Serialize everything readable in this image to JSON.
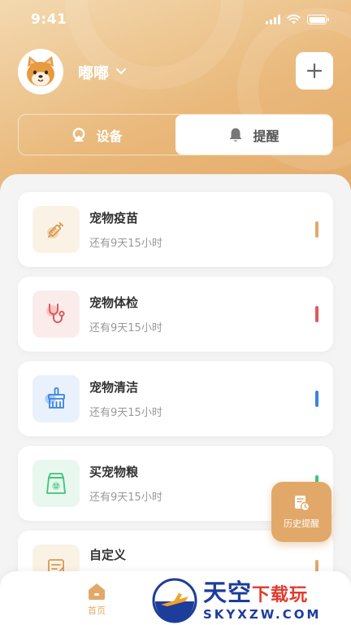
{
  "status_bar": {
    "time": "9:41"
  },
  "profile": {
    "pet_name": "嘟嘟"
  },
  "segment": {
    "tabs": [
      {
        "label": "设备",
        "icon": "location-pin-icon",
        "active": false
      },
      {
        "label": "提醒",
        "icon": "bell-icon",
        "active": true
      }
    ]
  },
  "reminders": [
    {
      "title": "宠物疫苗",
      "subtitle": "还有9天15小时",
      "icon": "syringe-icon",
      "accent": "#e2a869",
      "icon_bg": "#fbf2e6"
    },
    {
      "title": "宠物体检",
      "subtitle": "还有9天15小时",
      "icon": "stethoscope-icon",
      "accent": "#e05a5a",
      "icon_bg": "#fbecec"
    },
    {
      "title": "宠物清洁",
      "subtitle": "还有9天15小时",
      "icon": "brush-icon",
      "accent": "#3b82e0",
      "icon_bg": "#e9f2fc"
    },
    {
      "title": "买宠物粮",
      "subtitle": "还有9天15小时",
      "icon": "food-bag-icon",
      "accent": "#3cc47a",
      "icon_bg": "#e8f8ee"
    },
    {
      "title": "自定义",
      "subtitle": "",
      "icon": "edit-note-icon",
      "accent": "#e2a869",
      "icon_bg": "#fbf2e6"
    }
  ],
  "history_button": {
    "label": "历史提醒"
  },
  "tab_bar": {
    "home_label": "首页"
  },
  "watermark": {
    "line1": "天空",
    "line1_accent": "下载玩",
    "line2": "SKYXZW.COM"
  },
  "colors": {
    "accent": "#e2a869",
    "header_gradient_start": "#f3d9b0",
    "header_gradient_end": "#e4aa68"
  }
}
